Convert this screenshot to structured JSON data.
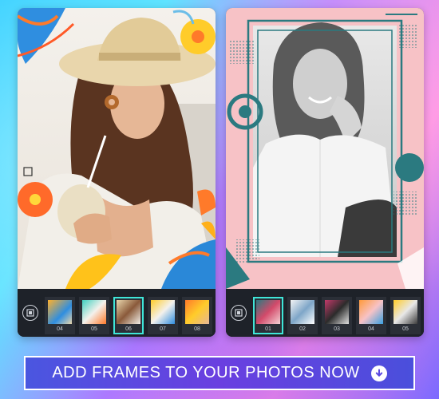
{
  "left_phone": {
    "thumbnails": [
      {
        "label": "04",
        "selected": false
      },
      {
        "label": "05",
        "selected": false
      },
      {
        "label": "06",
        "selected": true
      },
      {
        "label": "07",
        "selected": false
      },
      {
        "label": "08",
        "selected": false
      }
    ]
  },
  "right_phone": {
    "thumbnails": [
      {
        "label": "01",
        "selected": true
      },
      {
        "label": "02",
        "selected": false
      },
      {
        "label": "03",
        "selected": false
      },
      {
        "label": "04",
        "selected": false
      },
      {
        "label": "05",
        "selected": false
      }
    ]
  },
  "cta": {
    "label": "ADD FRAMES TO YOUR PHOTOS NOW",
    "icon": "download-arrow-icon"
  },
  "colors": {
    "selection_accent": "#3fe6d8",
    "cta_background": "#5a48e0",
    "toolbar_background": "#1e2229",
    "frame_pink": "#f7c2c6",
    "frame_teal": "#2b7a80"
  }
}
